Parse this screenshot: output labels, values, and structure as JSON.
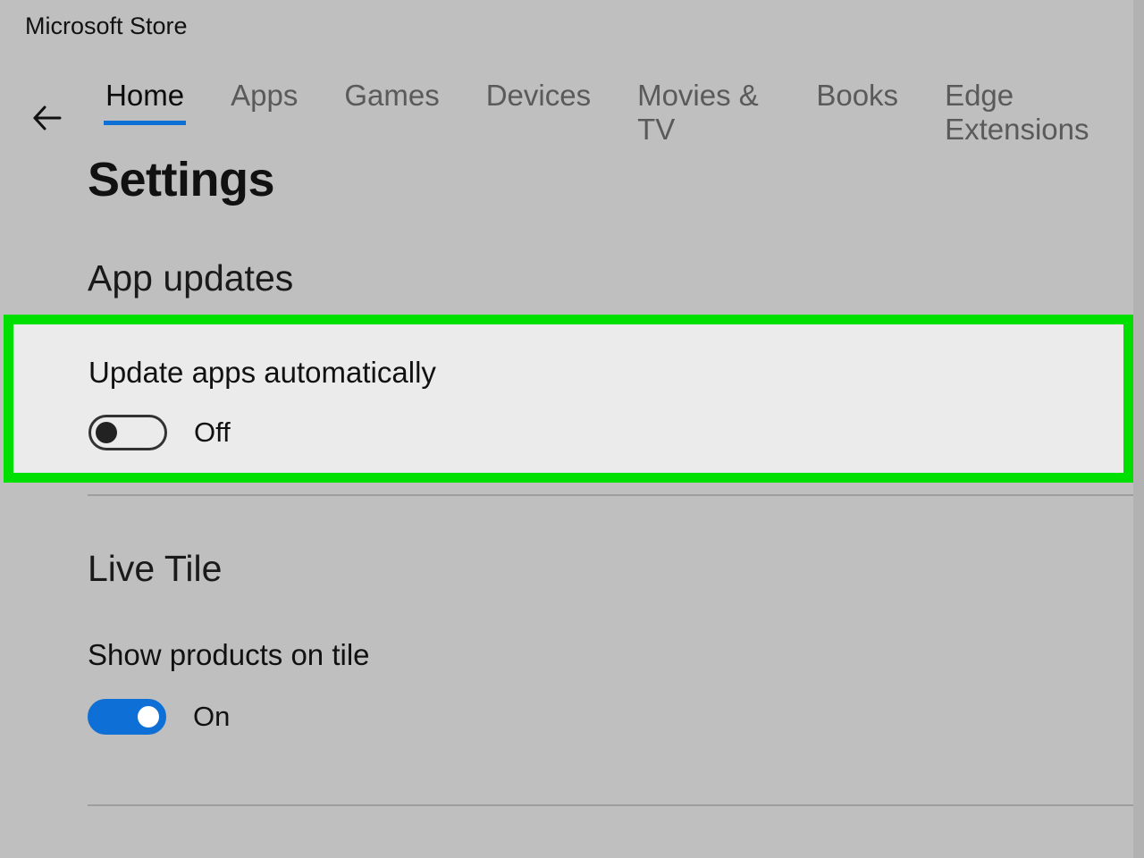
{
  "app": {
    "title": "Microsoft Store"
  },
  "nav": {
    "tabs": [
      {
        "label": "Home",
        "active": true
      },
      {
        "label": "Apps",
        "active": false
      },
      {
        "label": "Games",
        "active": false
      },
      {
        "label": "Devices",
        "active": false
      },
      {
        "label": "Movies & TV",
        "active": false
      },
      {
        "label": "Books",
        "active": false
      },
      {
        "label": "Edge Extensions",
        "active": false
      }
    ]
  },
  "page": {
    "title": "Settings"
  },
  "sections": {
    "app_updates": {
      "heading": "App updates",
      "setting_label": "Update apps automatically",
      "toggle_state": "Off"
    },
    "live_tile": {
      "heading": "Live Tile",
      "setting_label": "Show products on tile",
      "toggle_state": "On"
    }
  },
  "colors": {
    "highlight_border": "#00e000",
    "accent": "#0e6fd6"
  }
}
